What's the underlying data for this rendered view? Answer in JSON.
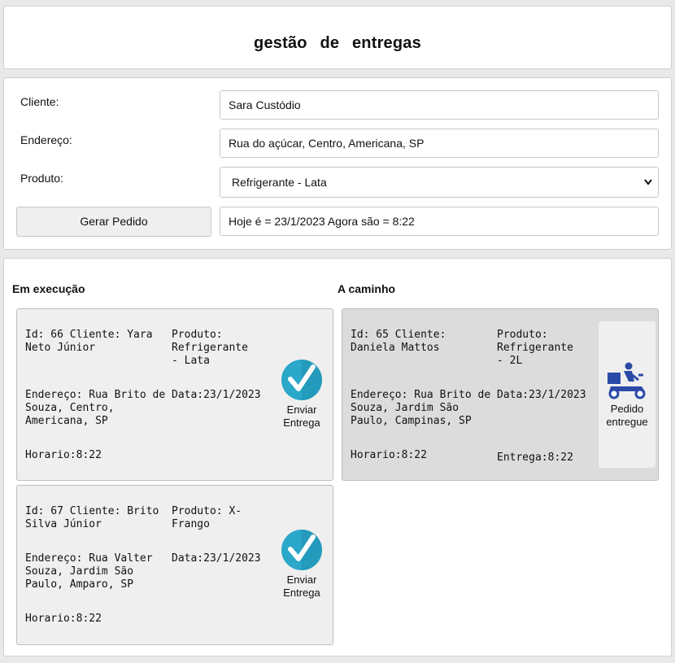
{
  "header": {
    "title": "gestão de entregas"
  },
  "form": {
    "cliente_label": "Cliente:",
    "cliente_value": "Sara Custódio",
    "endereco_label": "Endereço:",
    "endereco_value": "Rua do açúcar, Centro, Americana, SP",
    "produto_label": "Produto:",
    "produto_selected": "Refrigerante - Lata",
    "gerar_button": "Gerar Pedido",
    "status_value": "Hoje é = 23/1/2023 Agora são = 8:22"
  },
  "em_execucao": {
    "title": "Em execução",
    "action_label_1": "Enviar",
    "action_label_2": "Entrega",
    "orders": [
      {
        "id_cliente": "Id: 66 Cliente: Yara Neto Júnior",
        "produto": "Produto: Refrigerante - Lata",
        "endereco": "Endereço: Rua Brito de Souza, Centro, Americana, SP",
        "data": "Data:23/1/2023",
        "horario": "Horario:8:22"
      },
      {
        "id_cliente": "Id: 67 Cliente: Brito Silva Júnior",
        "produto": "Produto: X-Frango",
        "endereco": "Endereço: Rua Valter Souza, Jardim São Paulo, Amparo, SP",
        "data": "Data:23/1/2023",
        "horario": "Horario:8:22"
      }
    ]
  },
  "a_caminho": {
    "title": "A caminho",
    "action_label_1": "Pedido",
    "action_label_2": "entregue",
    "orders": [
      {
        "id_cliente": "Id: 65 Cliente: Daniela Mattos",
        "produto": "Produto: Refrigerante - 2L",
        "endereco": "Endereço: Rua Brito de Souza, Jardim São Paulo, Campinas, SP",
        "data": "Data:23/1/2023",
        "horario": "Horario:8:22",
        "entrega": "Entrega:8:22"
      }
    ]
  },
  "colors": {
    "check_icon": "#2aa7c9",
    "delivery_icon": "#2b4aa8",
    "exec_card_bg": "#efefef",
    "caminho_card_bg": "#dcdcdc"
  },
  "icons": {
    "check": "check-circle-icon",
    "delivery": "delivery-scooter-icon",
    "select": "chevron-down-icon"
  }
}
